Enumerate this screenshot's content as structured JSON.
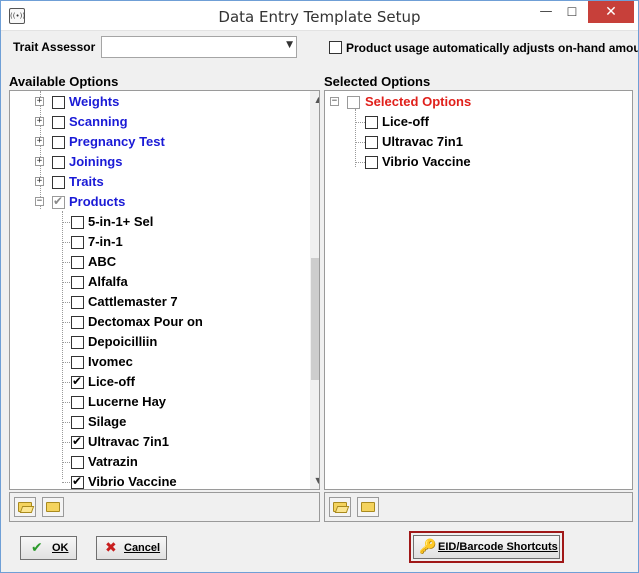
{
  "window": {
    "title": "Data Entry Template Setup",
    "icon_label": "((•))",
    "minimize_glyph": "—",
    "maximize_glyph": "☐",
    "close_glyph": "✕"
  },
  "trait_assessor": {
    "label": "Trait Assessor",
    "value": ""
  },
  "auto_adjust": {
    "label": "Product usage automatically adjusts on-hand amour",
    "checked": false
  },
  "available": {
    "heading": "Available Options",
    "groups": [
      {
        "label": "Weights",
        "expander": "+",
        "checked": false
      },
      {
        "label": "Scanning",
        "expander": "+",
        "checked": false
      },
      {
        "label": "Pregnancy Test",
        "expander": "+",
        "checked": false
      },
      {
        "label": "Joinings",
        "expander": "+",
        "checked": false
      },
      {
        "label": "Traits",
        "expander": "+",
        "checked": false
      },
      {
        "label": "Products",
        "expander": "−",
        "checked": true
      }
    ],
    "products": [
      {
        "label": "5-in-1+ Sel",
        "checked": false
      },
      {
        "label": "7-in-1",
        "checked": false
      },
      {
        "label": "ABC",
        "checked": false
      },
      {
        "label": "Alfalfa",
        "checked": false
      },
      {
        "label": "Cattlemaster 7",
        "checked": false
      },
      {
        "label": "Dectomax Pour on",
        "checked": false
      },
      {
        "label": "Depoicilliin",
        "checked": false
      },
      {
        "label": "Ivomec",
        "checked": false
      },
      {
        "label": "Lice-off",
        "checked": true
      },
      {
        "label": "Lucerne Hay",
        "checked": false
      },
      {
        "label": "Silage",
        "checked": false
      },
      {
        "label": "Ultravac 7in1",
        "checked": true
      },
      {
        "label": "Vatrazin",
        "checked": false
      },
      {
        "label": "Vibrio Vaccine",
        "checked": true
      }
    ]
  },
  "selected": {
    "heading": "Selected Options",
    "root": {
      "label": "Selected Options",
      "expander": "−",
      "checked": false
    },
    "items": [
      {
        "label": "Lice-off",
        "checked": false
      },
      {
        "label": "Ultravac 7in1",
        "checked": false
      },
      {
        "label": "Vibrio Vaccine",
        "checked": false
      }
    ]
  },
  "buttons": {
    "ok_label": "OK",
    "ok_icon": "✔",
    "cancel_label": "Cancel",
    "cancel_icon": "✖",
    "shortcuts_label": "EID/Barcode Shortcuts",
    "shortcuts_icon": "🔑"
  },
  "colors": {
    "group_text": "#1a1ad6",
    "selected_root_text": "#e0201b",
    "close_button": "#c7403a",
    "highlight_border": "#a01818"
  }
}
